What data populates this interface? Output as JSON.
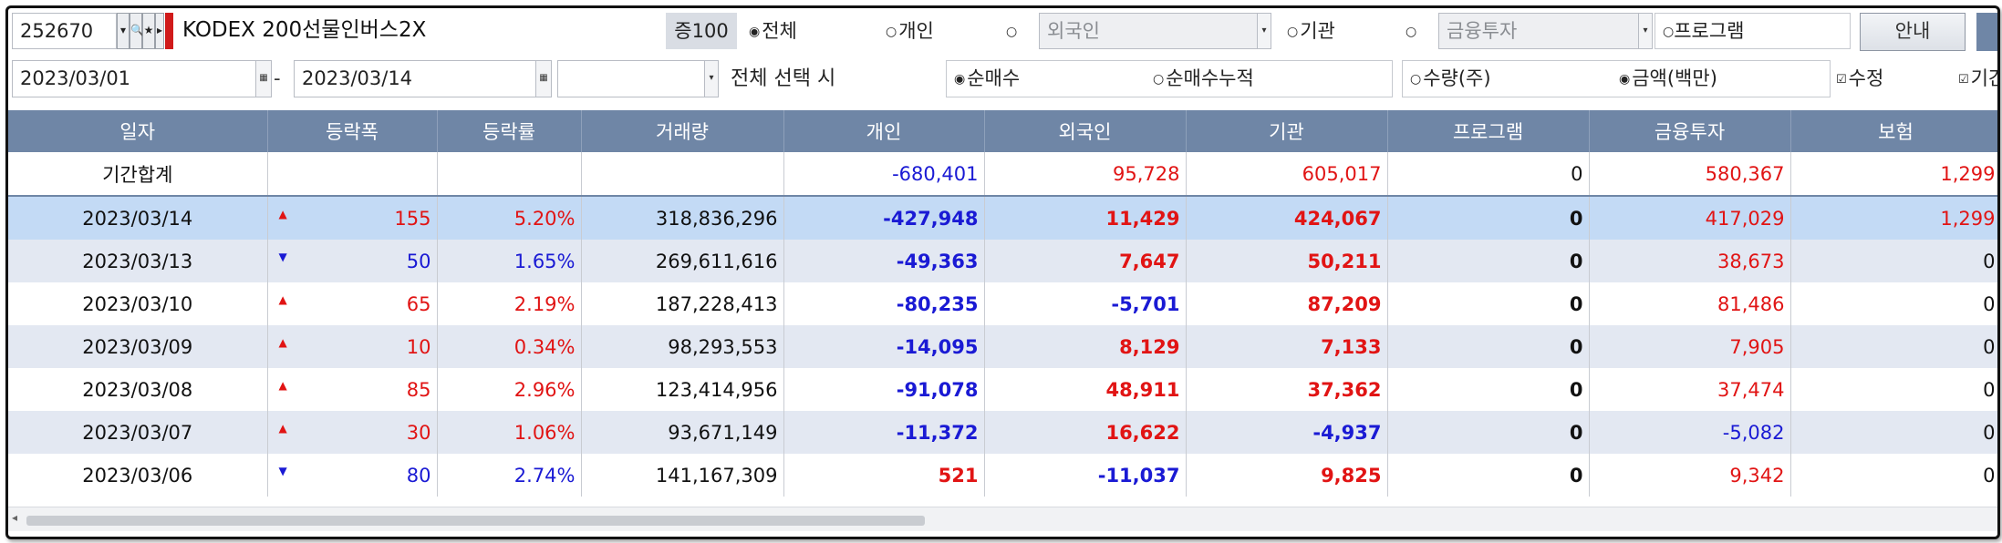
{
  "toolbar": {
    "code": "252670",
    "btn_dropdown": "▾",
    "btn_search": "🔍",
    "btn_star": "★",
    "btn_more": "▸",
    "stock_name": "KODEX 200선물인버스2X",
    "margin_badge": "증100",
    "investor_radios": [
      "전체",
      "개인",
      "외국인",
      "기관",
      "금융투자",
      "프로그램"
    ],
    "guide_button": "안내"
  },
  "filters": {
    "start_date": "2023/03/01",
    "end_date": "2023/03/14",
    "dash": "-",
    "blank_select": "",
    "all_select_label": "전체 선택 시",
    "mode_radios": [
      "순매수",
      "순매수누적"
    ],
    "unit_radios": [
      "수량(주)",
      "금액(백만)"
    ],
    "check_edit": "수정",
    "check_other": "기간"
  },
  "table": {
    "headers": [
      "일자",
      "등락폭",
      "등락률",
      "거래량",
      "개인",
      "외국인",
      "기관",
      "프로그램",
      "금융투자",
      "보험"
    ],
    "summary": {
      "label": "기간합계",
      "personal": "-680,401",
      "foreign": "95,728",
      "institution": "605,017",
      "program": "0",
      "finance": "580,367",
      "insurance": "1,299"
    },
    "rows": [
      {
        "date": "2023/03/14",
        "dir": "▲",
        "change": "155",
        "rate": "5.20%",
        "volume": "318,836,296",
        "personal": "-427,948",
        "foreign": "11,429",
        "institution": "424,067",
        "program": "0",
        "finance": "417,029",
        "insurance": "1,299"
      },
      {
        "date": "2023/03/13",
        "dir": "▼",
        "change": "50",
        "rate": "1.65%",
        "volume": "269,611,616",
        "personal": "-49,363",
        "foreign": "7,647",
        "institution": "50,211",
        "program": "0",
        "finance": "38,673",
        "insurance": "0"
      },
      {
        "date": "2023/03/10",
        "dir": "▲",
        "change": "65",
        "rate": "2.19%",
        "volume": "187,228,413",
        "personal": "-80,235",
        "foreign": "-5,701",
        "institution": "87,209",
        "program": "0",
        "finance": "81,486",
        "insurance": "0"
      },
      {
        "date": "2023/03/09",
        "dir": "▲",
        "change": "10",
        "rate": "0.34%",
        "volume": "98,293,553",
        "personal": "-14,095",
        "foreign": "8,129",
        "institution": "7,133",
        "program": "0",
        "finance": "7,905",
        "insurance": "0"
      },
      {
        "date": "2023/03/08",
        "dir": "▲",
        "change": "85",
        "rate": "2.96%",
        "volume": "123,414,956",
        "personal": "-91,078",
        "foreign": "48,911",
        "institution": "37,362",
        "program": "0",
        "finance": "37,474",
        "insurance": "0"
      },
      {
        "date": "2023/03/07",
        "dir": "▲",
        "change": "30",
        "rate": "1.06%",
        "volume": "93,671,149",
        "personal": "-11,372",
        "foreign": "16,622",
        "institution": "-4,937",
        "program": "0",
        "finance": "-5,082",
        "insurance": "0"
      },
      {
        "date": "2023/03/06",
        "dir": "▼",
        "change": "80",
        "rate": "2.74%",
        "volume": "141,167,309",
        "personal": "521",
        "foreign": "-11,037",
        "institution": "9,825",
        "program": "0",
        "finance": "9,342",
        "insurance": "0"
      }
    ]
  },
  "colors": {
    "up": "#e11414",
    "down": "#1a1ad4",
    "header": "#6f86a6",
    "selected": "#c3daf5"
  }
}
